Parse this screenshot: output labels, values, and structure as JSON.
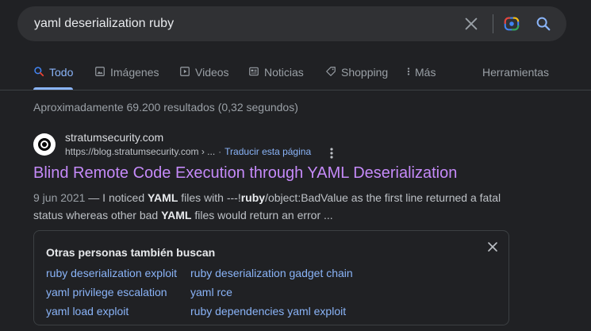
{
  "search": {
    "query": "yaml deserialization ruby",
    "icons": [
      "close-icon",
      "google-lens-icon",
      "search-icon"
    ]
  },
  "tabs": [
    {
      "label": "Todo",
      "icon": "search-icon",
      "active": true
    },
    {
      "label": "Imágenes",
      "icon": "image-icon"
    },
    {
      "label": "Videos",
      "icon": "play-icon"
    },
    {
      "label": "Noticias",
      "icon": "newspaper-icon"
    },
    {
      "label": "Shopping",
      "icon": "tag-icon"
    },
    {
      "label": "Más",
      "icon": "more-vert-icon"
    }
  ],
  "tools_label": "Herramientas",
  "stats": "Aproximadamente 69.200 resultados (0,32 segundos)",
  "result": {
    "site_name": "stratumsecurity.com",
    "url": "https://blog.stratumsecurity.com › ...",
    "translate": "Traducir esta página",
    "title": "Blind Remote Code Execution through YAML Deserialization",
    "date": "9 jun 2021",
    "snippet_parts": [
      " — I noticed ",
      "YAML",
      " files with ---!",
      "ruby",
      "/object:BadValue as the first line returned a fatal status whereas other bad ",
      "YAML",
      " files would return an error ..."
    ]
  },
  "people_also_search": {
    "title": "Otras personas también buscan",
    "links": [
      "ruby deserialization exploit",
      "ruby deserialization gadget chain",
      "yaml privilege escalation",
      "yaml rce",
      "yaml load exploit",
      "ruby dependencies yaml exploit"
    ]
  },
  "colors": {
    "background": "#202124",
    "link": "#8ab4f8",
    "visited_title": "#c58af9",
    "text": "#bdc1c6"
  }
}
